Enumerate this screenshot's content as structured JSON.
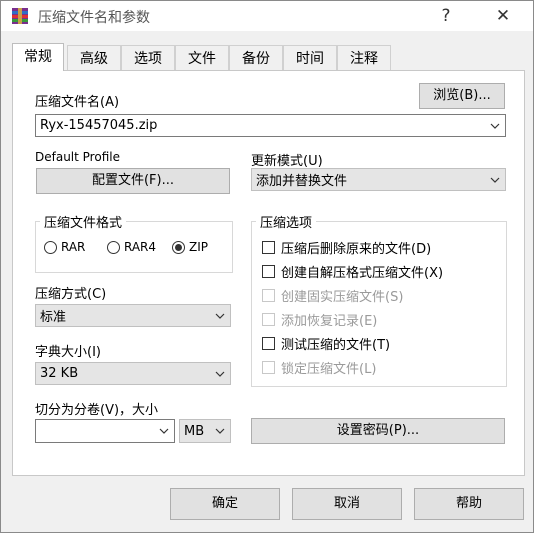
{
  "window": {
    "title": "压缩文件名和参数",
    "help_glyph": "?",
    "close_glyph": "✕"
  },
  "tabs": [
    {
      "label": "常规"
    },
    {
      "label": "高级"
    },
    {
      "label": "选项"
    },
    {
      "label": "文件"
    },
    {
      "label": "备份"
    },
    {
      "label": "时间"
    },
    {
      "label": "注释"
    }
  ],
  "archive_name": {
    "label": "压缩文件名(A)",
    "browse_label": "浏览(B)...",
    "value": "Ryx-15457045.zip"
  },
  "profile": {
    "label": "Default Profile",
    "button_label": "配置文件(F)..."
  },
  "update_mode": {
    "label": "更新模式(U)",
    "value": "添加并替换文件"
  },
  "format": {
    "title": "压缩文件格式",
    "options": [
      {
        "label": "RAR",
        "selected": false
      },
      {
        "label": "RAR4",
        "selected": false
      },
      {
        "label": "ZIP",
        "selected": true
      }
    ]
  },
  "options_group": {
    "title": "压缩选项",
    "items": [
      {
        "label": "压缩后删除原来的文件(D)",
        "checked": false,
        "enabled": true
      },
      {
        "label": "创建自解压格式压缩文件(X)",
        "checked": false,
        "enabled": true
      },
      {
        "label": "创建固实压缩文件(S)",
        "checked": false,
        "enabled": false
      },
      {
        "label": "添加恢复记录(E)",
        "checked": false,
        "enabled": false
      },
      {
        "label": "测试压缩的文件(T)",
        "checked": false,
        "enabled": true
      },
      {
        "label": "锁定压缩文件(L)",
        "checked": false,
        "enabled": false
      }
    ]
  },
  "method": {
    "label": "压缩方式(C)",
    "value": "标准"
  },
  "dictionary": {
    "label": "字典大小(I)",
    "value": "32 KB"
  },
  "split": {
    "label": "切分为分卷(V)，大小",
    "value": "",
    "unit": "MB"
  },
  "password_button": "设置密码(P)...",
  "footer": {
    "ok": "确定",
    "cancel": "取消",
    "help": "帮助"
  }
}
